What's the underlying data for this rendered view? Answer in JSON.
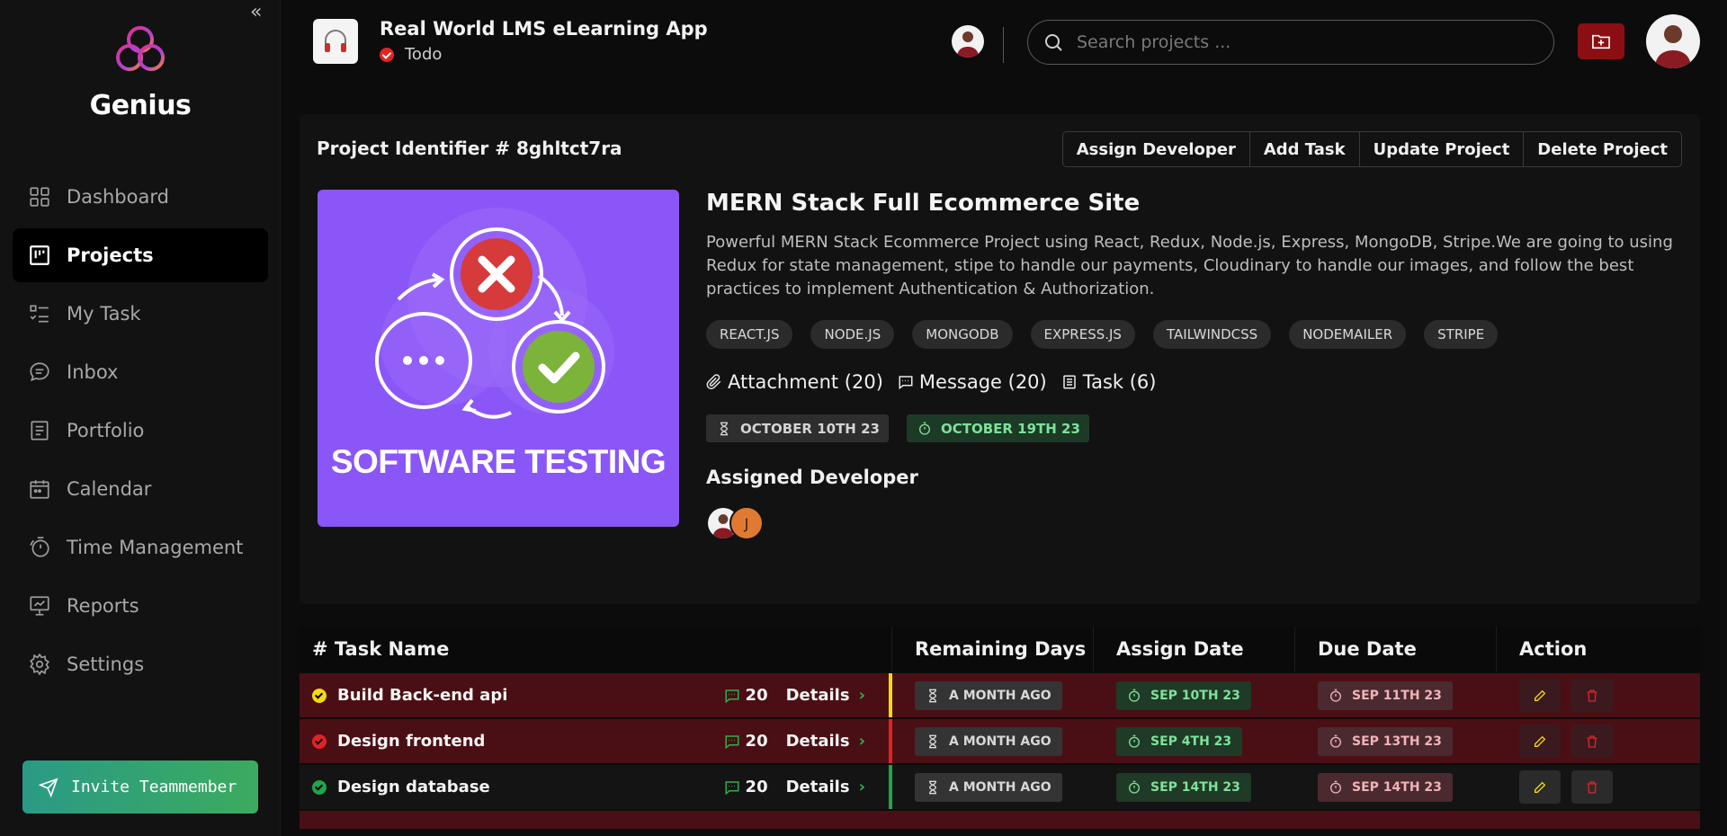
{
  "sidebar": {
    "brand": "Genius",
    "collapse_icon": "«",
    "items": [
      {
        "label": "Dashboard",
        "icon": "grid-icon"
      },
      {
        "label": "Projects",
        "icon": "board-icon",
        "active": true
      },
      {
        "label": "My Task",
        "icon": "task-list-icon"
      },
      {
        "label": "Inbox",
        "icon": "chat-icon"
      },
      {
        "label": "Portfolio",
        "icon": "document-icon"
      },
      {
        "label": "Calendar",
        "icon": "calendar-icon"
      },
      {
        "label": "Time Management",
        "icon": "timer-icon"
      },
      {
        "label": "Reports",
        "icon": "presentation-chart-icon"
      },
      {
        "label": "Settings",
        "icon": "gear-icon"
      }
    ],
    "invite_label": "Invite Teammember"
  },
  "header": {
    "project_title": "Real World LMS eLearning App",
    "status": "Todo",
    "search_placeholder": "Search projects ..."
  },
  "project": {
    "identifier": "Project Identifier # 8ghltct7ra",
    "actions": [
      "Assign Developer",
      "Add Task",
      "Update Project",
      "Delete Project"
    ],
    "cover_text": "SOFTWARE TESTING",
    "title": "MERN Stack Full Ecommerce Site",
    "description": "Powerful MERN Stack Ecommerce Project using React, Redux, Node.js, Express, MongoDB, Stripe.We are going to using Redux for state management, stipe to handle our payments, Cloudinary to handle our images, and follow the best practices to implement Authentication & Authorization.",
    "tags": [
      "REACT.JS",
      "NODE.JS",
      "MONGODB",
      "EXPRESS.JS",
      "TAILWINDCSS",
      "NODEMAILER",
      "STRIPE"
    ],
    "attachment": "Attachment (20)",
    "message": "Message (20)",
    "task": "Task (6)",
    "start_date": "OCTOBER 10TH 23",
    "end_date": "OCTOBER 19TH 23",
    "assigned_label": "Assigned Developer",
    "dev_initial": "J"
  },
  "table": {
    "headers": [
      "# Task Name",
      "Remaining Days",
      "Assign Date",
      "Due Date",
      "Action"
    ],
    "details_label": "Details",
    "rows": [
      {
        "name": "Build Back-end api",
        "count": "20",
        "remaining": "A MONTH AGO",
        "assign": "SEP 10TH 23",
        "due": "SEP 11TH 23",
        "status_color": "#f5d90a",
        "row_style": "red"
      },
      {
        "name": "Design frontend",
        "count": "20",
        "remaining": "A MONTH AGO",
        "assign": "SEP 4TH 23",
        "due": "SEP 13TH 23",
        "status_color": "#e02424",
        "row_style": "red"
      },
      {
        "name": "Design database",
        "count": "20",
        "remaining": "A MONTH AGO",
        "assign": "SEP 14TH 23",
        "due": "SEP 14TH 23",
        "status_color": "#22a447",
        "row_style": "dark"
      }
    ]
  },
  "colors": {
    "accent_red": "#8b0f12",
    "invite_gradient_start": "#2a9a86",
    "invite_gradient_end": "#3cab5e",
    "cover_purple": "#8a56f7"
  }
}
